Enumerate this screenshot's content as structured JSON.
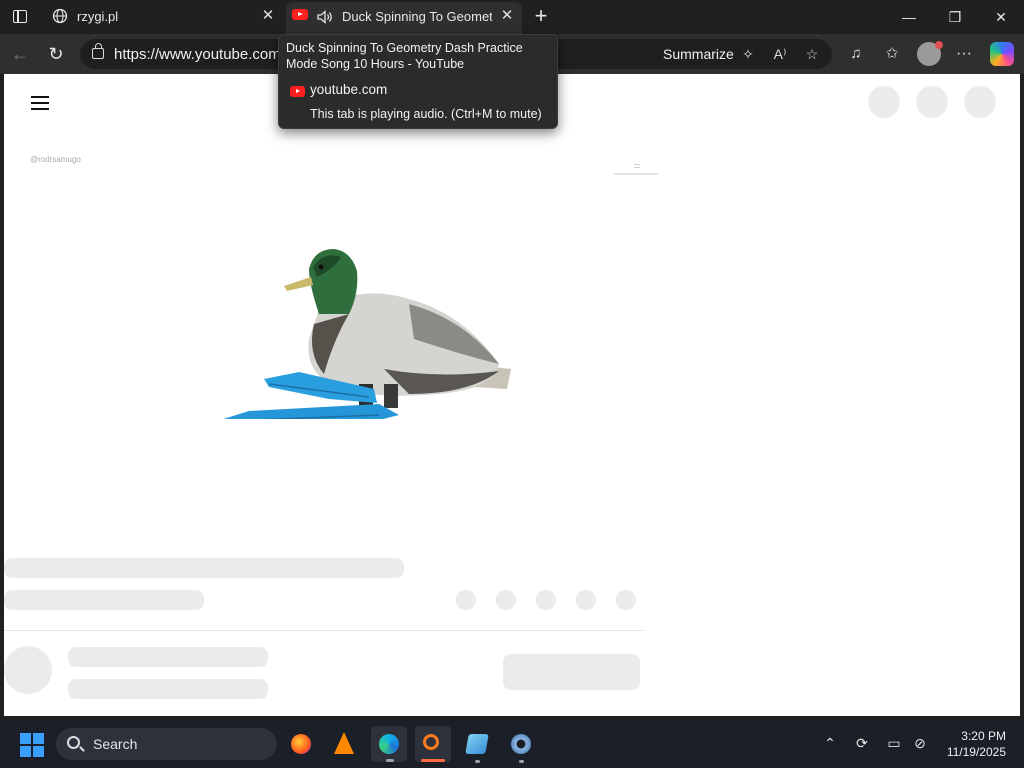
{
  "browser": {
    "tabs": [
      {
        "title": "rzygi.pl",
        "close": "✕"
      },
      {
        "title": "Duck Spinning To Geometry",
        "close": "✕"
      }
    ],
    "new_tab": "+",
    "window_controls": {
      "minimize": "—",
      "maximize": "❐",
      "close": "✕"
    },
    "toolbar": {
      "url": "https://www.youtube.com/",
      "summarize_label": "Summarize",
      "more": "···"
    }
  },
  "tooltip": {
    "title": "Duck Spinning To Geometry Dash Practice Mode Song 10 Hours - YouTube",
    "domain": "youtube.com",
    "audio_note": "This tab is playing audio. (Ctrl+M to mute)"
  },
  "video": {
    "watermark": "@rodrsamugo"
  },
  "taskbar": {
    "search_label": "Search",
    "time": "3:20 PM",
    "date": "11/19/2025",
    "apps": [
      "firefox",
      "vlc",
      "edge",
      "magnifier",
      "notepad",
      "settings"
    ]
  },
  "colors": {
    "youtube_red": "#ff1f1f",
    "placeholder_gray": "#ebebeb",
    "duck_fins": "#2a9fe0"
  }
}
